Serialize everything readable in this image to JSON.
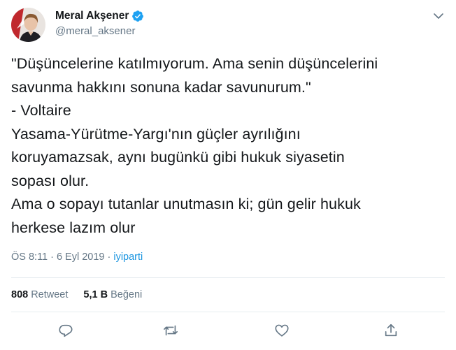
{
  "author": {
    "display_name": "Meral Akşener",
    "handle": "@meral_aksener",
    "avatar_icon": "profile-photo",
    "verified_icon": "verified-badge-icon"
  },
  "tweet": {
    "lines": [
      "\"Düşüncelerine katılmıyorum. Ama senin düşüncelerini",
      "savunma hakkını sonuna kadar savunurum.\"",
      "- Voltaire",
      "Yasama-Yürütme-Yargı'nın güçler ayrılığını",
      "koruyamazsak, aynı bugünkü gibi hukuk siyasetin",
      "sopası olur.",
      "Ama o sopayı tutanlar unutmasın ki; gün gelir hukuk",
      "herkese lazım olur"
    ],
    "time": "ÖS 8:11",
    "date": "6 Eyl 2019",
    "separator": "·",
    "source": "iyiparti"
  },
  "stats": {
    "retweets_count": "808",
    "retweets_label": "Retweet",
    "likes_count": "5,1 B",
    "likes_label": "Beğeni"
  },
  "actions": [
    "reply-icon",
    "retweet-icon",
    "like-icon",
    "share-icon"
  ],
  "colors": {
    "text": "#14171a",
    "muted": "#657786",
    "link": "#1b95e0",
    "divider": "#e6ecf0",
    "verified": "#1da1f2"
  }
}
